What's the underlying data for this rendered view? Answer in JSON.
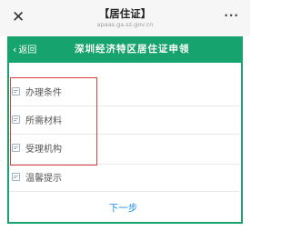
{
  "window": {
    "close_glyph": "✕",
    "title": "【居住证】",
    "domain": "apaas.ga.sz.gov.cn",
    "more_glyph": "···"
  },
  "header": {
    "back_label": "返回",
    "back_glyph": "‹",
    "title": "深圳经济特区居住证申领",
    "accent_color": "#16a36d"
  },
  "menu": {
    "items": [
      {
        "label": "办理条件",
        "icon": "document-icon"
      },
      {
        "label": "所需材料",
        "icon": "document-icon"
      },
      {
        "label": "受理机构",
        "icon": "document-icon"
      },
      {
        "label": "温馨提示",
        "icon": "document-icon"
      }
    ],
    "highlight_color": "#d94040"
  },
  "footer": {
    "next_label": "下一步",
    "next_color": "#1f8ee8"
  }
}
